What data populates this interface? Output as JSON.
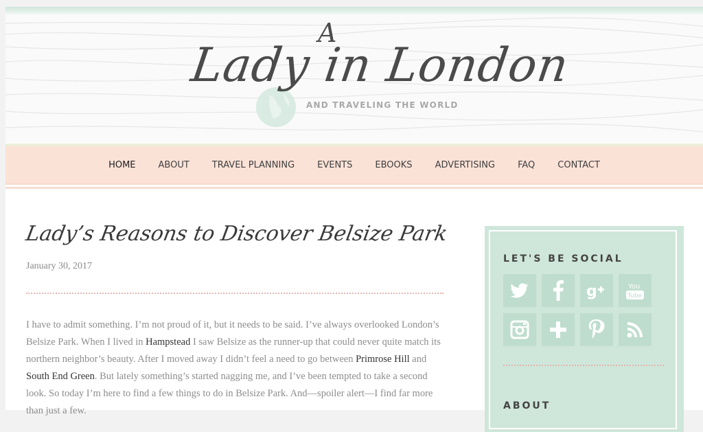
{
  "header": {
    "logo_a": "A",
    "logo_title": "Lady in London",
    "logo_tagline": "AND TRAVELING THE WORLD"
  },
  "nav": {
    "items": [
      {
        "label": "HOME",
        "active": true
      },
      {
        "label": "ABOUT"
      },
      {
        "label": "TRAVEL PLANNING"
      },
      {
        "label": "EVENTS"
      },
      {
        "label": "EBOOKS"
      },
      {
        "label": "ADVERTISING"
      },
      {
        "label": "FAQ"
      },
      {
        "label": "CONTACT"
      }
    ]
  },
  "post": {
    "title": "Lady’s Reasons to Discover Belsize Park",
    "date": "January 30, 2017",
    "body": {
      "t1": "I have to admit something. I’m not proud of it, but it needs to be said. I’ve always overlooked London’s Belsize Park. When I lived in ",
      "link_hampstead": "Hampstead",
      "t2": " I saw Belsize as the runner-up that could never quite match its northern neighbor’s beauty.  After I moved away I didn’t feel a need to go between ",
      "link_primrose": "Primrose Hill",
      "t3": " and ",
      "link_south_end": "South End Green",
      "t4": ". But lately something’s started nagging me, and I’ve been tempted to take a second look. So today I’m here to find a few things to do in Belsize Park. And—spoiler alert—I find far more than just a few."
    }
  },
  "sidebar": {
    "social_heading": "LET'S BE SOCIAL",
    "about_heading": "ABOUT",
    "social_icons": [
      "twitter-icon",
      "facebook-icon",
      "google-plus-icon",
      "youtube-icon",
      "instagram-icon",
      "plus-icon",
      "pinterest-icon",
      "rss-icon"
    ],
    "youtube_you": "You",
    "youtube_tube": "Tube"
  },
  "colors": {
    "nav_bg": "#fbe2d7",
    "sidebar_bg": "#cfe6da",
    "tile_bg": "#bfddce",
    "separator": "#e3b7b0"
  }
}
